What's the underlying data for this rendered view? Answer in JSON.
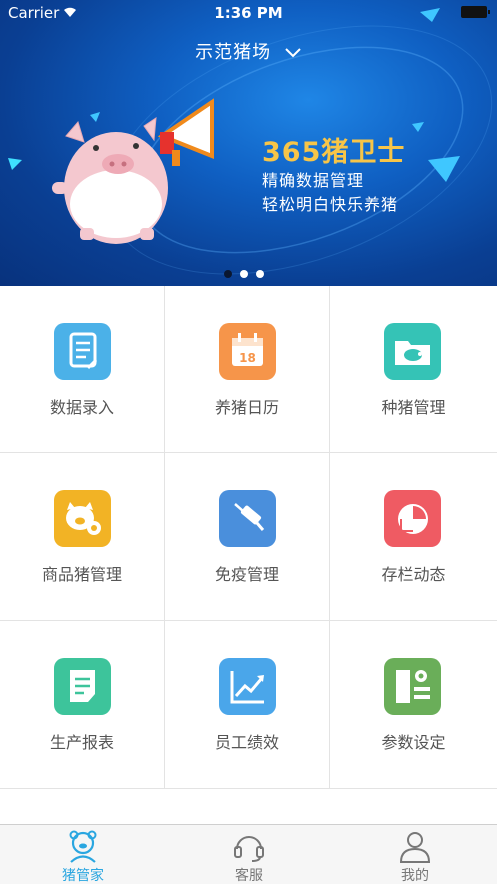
{
  "status": {
    "carrier": "Carrier",
    "time": "1:36 PM"
  },
  "header": {
    "farm_name": "示范猪场"
  },
  "banner": {
    "title": "365猪卫士",
    "line1": "精确数据管理",
    "line2": "轻松明白快乐养猪",
    "page_count": 3,
    "active_page": 1
  },
  "menu": [
    {
      "label": "数据录入",
      "icon": "document-icon",
      "color": "#4bb1e8"
    },
    {
      "label": "养猪日历",
      "icon": "calendar-icon",
      "color": "#f6954a"
    },
    {
      "label": "种猪管理",
      "icon": "folder-pig-icon",
      "color": "#35c3b6"
    },
    {
      "label": "商品猪管理",
      "icon": "pig-gear-icon",
      "color": "#f2b325"
    },
    {
      "label": "免疫管理",
      "icon": "syringe-icon",
      "color": "#4a8fdc"
    },
    {
      "label": "存栏动态",
      "icon": "pie-chart-icon",
      "color": "#ef5b63"
    },
    {
      "label": "生产报表",
      "icon": "report-icon",
      "color": "#3dc49b"
    },
    {
      "label": "员工绩效",
      "icon": "line-chart-icon",
      "color": "#4aa6ea"
    },
    {
      "label": "参数设定",
      "icon": "settings-icon",
      "color": "#6aae59"
    }
  ],
  "tabs": [
    {
      "label": "猪管家",
      "icon": "pig-manager-icon",
      "active": true
    },
    {
      "label": "客服",
      "icon": "headset-icon",
      "active": false
    },
    {
      "label": "我的",
      "icon": "user-icon",
      "active": false
    }
  ],
  "colors": {
    "accent": "#2aa6e0",
    "title_yellow": "#f7c548"
  }
}
